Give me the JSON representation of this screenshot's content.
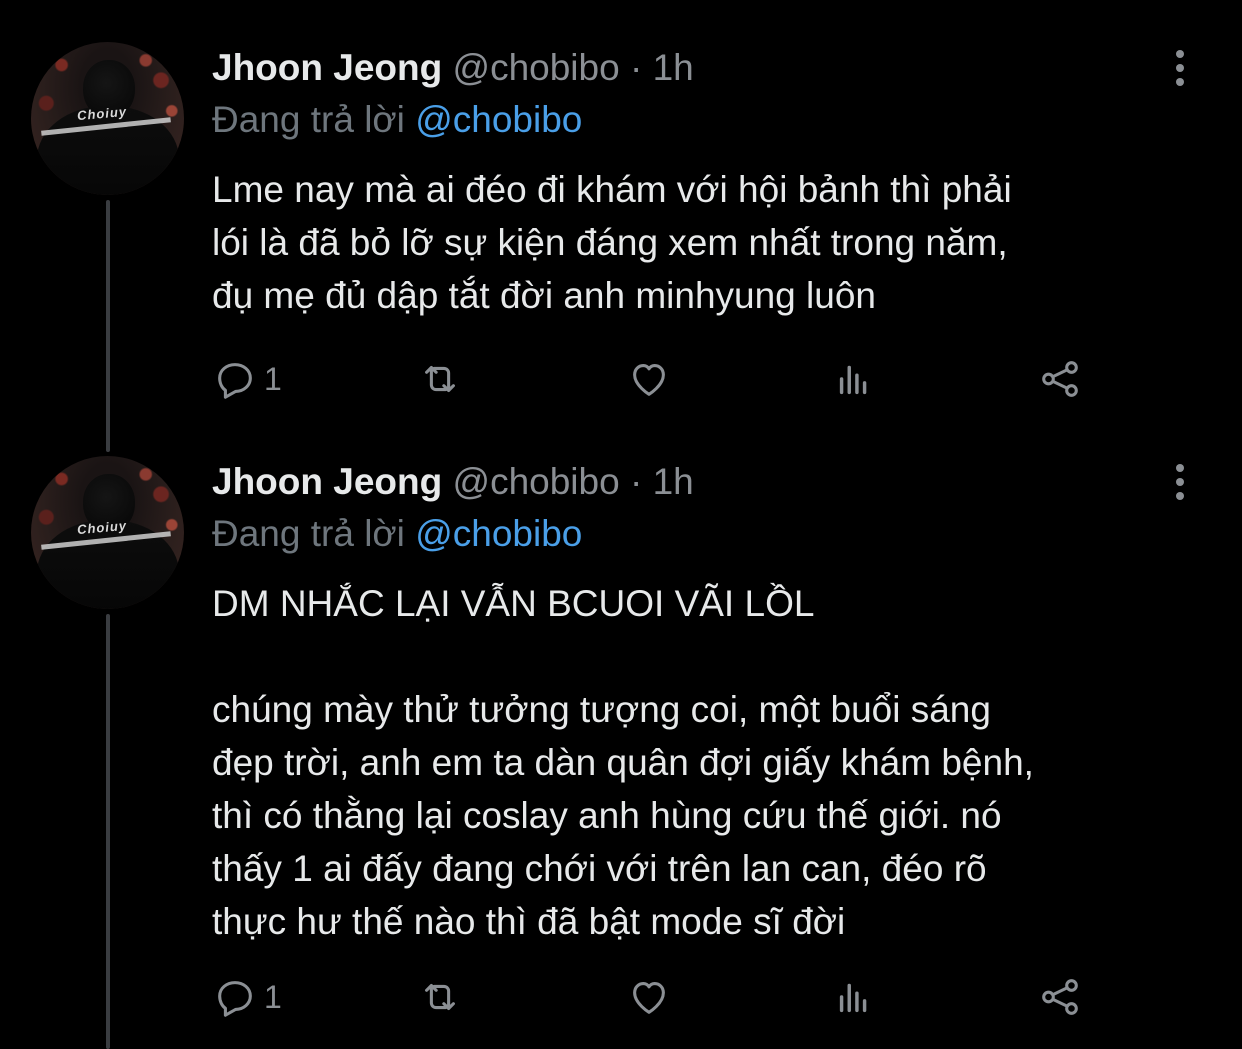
{
  "tweets": [
    {
      "name": "Jhoon Jeong",
      "handle": "@chobibo",
      "separator": "·",
      "time": "1h",
      "reply_prefix": "Đang trả lời",
      "reply_to": "@chobibo",
      "text": "Lme nay mà ai đéo đi khám với hội bảnh thì phải\nlói là đã bỏ lỡ sự kiện đáng xem nhất trong năm,\nđụ mẹ đủ dập tắt đời anh minhyung luôn",
      "reply_count": "1",
      "icons": [
        "reply-icon",
        "retweet-icon",
        "like-icon",
        "analytics-icon",
        "share-icon",
        "more-icon"
      ]
    },
    {
      "name": "Jhoon Jeong",
      "handle": "@chobibo",
      "separator": "·",
      "time": "1h",
      "reply_prefix": "Đang trả lời",
      "reply_to": "@chobibo",
      "text": "DM NHẮC LẠI VẪN BCUOI VÃI LỒL\n\nchúng mày thử tưởng tượng coi, một buổi sáng\nđẹp trời, anh em ta dàn quân đợi giấy khám bệnh,\nthì có thằng lại coslay anh hùng cứu thế giới. nó\nthấy 1 ai đấy đang chới với trên lan can, đéo rõ\nthực hư thế nào thì đã bật mode sĩ đời",
      "reply_count": "1",
      "icons": [
        "reply-icon",
        "retweet-icon",
        "like-icon",
        "analytics-icon",
        "share-icon",
        "more-icon"
      ]
    }
  ],
  "colors": {
    "background": "#000000",
    "text": "#e7e9ea",
    "secondary": "#8b8f94",
    "mention": "#4a9fe8",
    "thread_line": "#3a3d41"
  }
}
